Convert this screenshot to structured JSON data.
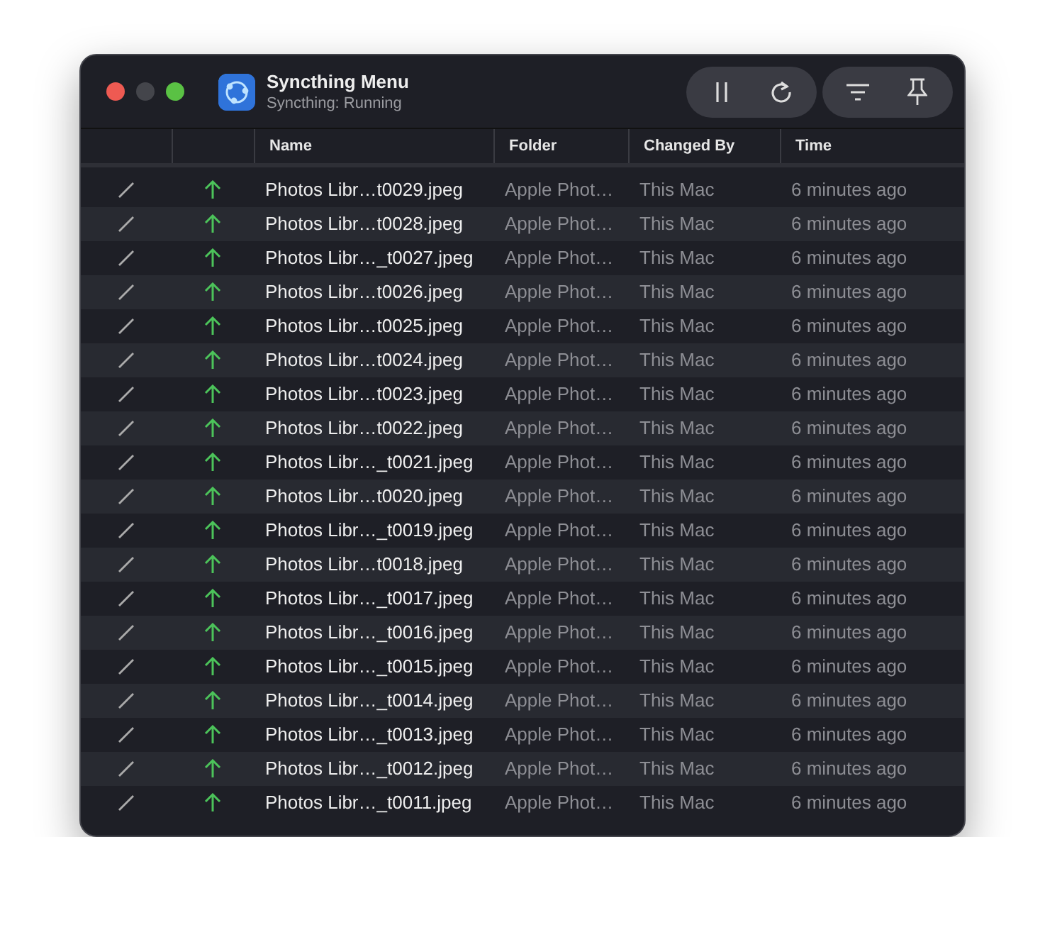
{
  "window": {
    "title": "Syncthing Menu",
    "subtitle": "Syncthing: Running"
  },
  "table": {
    "columns": [
      "",
      "",
      "Name",
      "Folder",
      "Changed By",
      "Time"
    ],
    "rows": [
      {
        "name": "Photos Libr…t0029.jpeg",
        "folder": "Apple Phot…",
        "changed_by": "This Mac",
        "time": "6 minutes ago"
      },
      {
        "name": "Photos Libr…t0028.jpeg",
        "folder": "Apple Phot…",
        "changed_by": "This Mac",
        "time": "6 minutes ago"
      },
      {
        "name": "Photos Libr…_t0027.jpeg",
        "folder": "Apple Phot…",
        "changed_by": "This Mac",
        "time": "6 minutes ago"
      },
      {
        "name": "Photos Libr…t0026.jpeg",
        "folder": "Apple Phot…",
        "changed_by": "This Mac",
        "time": "6 minutes ago"
      },
      {
        "name": "Photos Libr…t0025.jpeg",
        "folder": "Apple Phot…",
        "changed_by": "This Mac",
        "time": "6 minutes ago"
      },
      {
        "name": "Photos Libr…t0024.jpeg",
        "folder": "Apple Phot…",
        "changed_by": "This Mac",
        "time": "6 minutes ago"
      },
      {
        "name": "Photos Libr…t0023.jpeg",
        "folder": "Apple Phot…",
        "changed_by": "This Mac",
        "time": "6 minutes ago"
      },
      {
        "name": "Photos Libr…t0022.jpeg",
        "folder": "Apple Phot…",
        "changed_by": "This Mac",
        "time": "6 minutes ago"
      },
      {
        "name": "Photos Libr…_t0021.jpeg",
        "folder": "Apple Phot…",
        "changed_by": "This Mac",
        "time": "6 minutes ago"
      },
      {
        "name": "Photos Libr…t0020.jpeg",
        "folder": "Apple Phot…",
        "changed_by": "This Mac",
        "time": "6 minutes ago"
      },
      {
        "name": "Photos Libr…_t0019.jpeg",
        "folder": "Apple Phot…",
        "changed_by": "This Mac",
        "time": "6 minutes ago"
      },
      {
        "name": "Photos Libr…t0018.jpeg",
        "folder": "Apple Phot…",
        "changed_by": "This Mac",
        "time": "6 minutes ago"
      },
      {
        "name": "Photos Libr…_t0017.jpeg",
        "folder": "Apple Phot…",
        "changed_by": "This Mac",
        "time": "6 minutes ago"
      },
      {
        "name": "Photos Libr…_t0016.jpeg",
        "folder": "Apple Phot…",
        "changed_by": "This Mac",
        "time": "6 minutes ago"
      },
      {
        "name": "Photos Libr…_t0015.jpeg",
        "folder": "Apple Phot…",
        "changed_by": "This Mac",
        "time": "6 minutes ago"
      },
      {
        "name": "Photos Libr…_t0014.jpeg",
        "folder": "Apple Phot…",
        "changed_by": "This Mac",
        "time": "6 minutes ago"
      },
      {
        "name": "Photos Libr…_t0013.jpeg",
        "folder": "Apple Phot…",
        "changed_by": "This Mac",
        "time": "6 minutes ago"
      },
      {
        "name": "Photos Libr…_t0012.jpeg",
        "folder": "Apple Phot…",
        "changed_by": "This Mac",
        "time": "6 minutes ago"
      },
      {
        "name": "Photos Libr…_t0011.jpeg",
        "folder": "Apple Phot…",
        "changed_by": "This Mac",
        "time": "6 minutes ago"
      }
    ]
  }
}
